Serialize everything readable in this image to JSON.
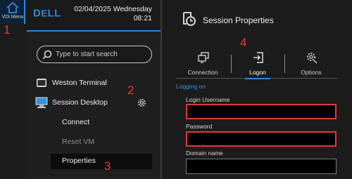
{
  "rail": {
    "menu_label": "VDI Menu"
  },
  "header": {
    "brand": "DELL",
    "date_line": "02/04/2025 Wednesday",
    "time": "08:21"
  },
  "search": {
    "placeholder": "Type to start search"
  },
  "menu": {
    "items": [
      {
        "label": "Weston Terminal"
      },
      {
        "label": "Session Desktop"
      },
      {
        "label": "Connect"
      },
      {
        "label": "Reset VM"
      },
      {
        "label": "Properties"
      }
    ]
  },
  "dialog": {
    "title": "Session Properties",
    "tabs": [
      {
        "label": "Connection"
      },
      {
        "label": "Logon"
      },
      {
        "label": "Options"
      }
    ],
    "active_tab": "Logon",
    "section_label": "Logging on",
    "fields": [
      {
        "label": "Login Username",
        "value": ""
      },
      {
        "label": "Password",
        "value": ""
      },
      {
        "label": "Domain name",
        "value": ""
      }
    ]
  },
  "annotations": [
    "1",
    "2",
    "3",
    "4"
  ],
  "colors": {
    "accent": "#2e86de",
    "annotation": "#e43a3a",
    "highlight_box": "#e23838",
    "background": "#1a1a1a"
  },
  "icons": [
    "home-icon",
    "search-icon",
    "terminal-icon",
    "desktop-icon",
    "gear-icon",
    "session-clock-icon",
    "connection-icon",
    "logon-icon",
    "options-gear-icon"
  ]
}
